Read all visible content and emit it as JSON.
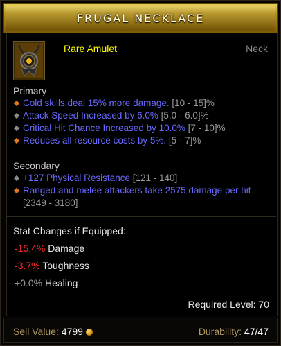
{
  "title": "FRUGAL NECKLACE",
  "item_type": "Rare Amulet",
  "slot": "Neck",
  "primary_label": "Primary",
  "primary_affixes": [
    {
      "text": "Cold skills deal 15% more damage.",
      "range": "[10 - 15]%",
      "bullet": "orange"
    },
    {
      "text": "Attack Speed Increased by 6.0%",
      "range": "[5.0 - 6.0]%",
      "bullet": "grey"
    },
    {
      "text": "Critical Hit Chance Increased by 10.0%",
      "range": "[7 - 10]%",
      "bullet": "grey"
    },
    {
      "text": "Reduces all resource costs by 5%.",
      "range": "[5 - 7]%",
      "bullet": "orange"
    }
  ],
  "secondary_label": "Secondary",
  "secondary_affixes": [
    {
      "text": "+127 Physical Resistance",
      "range": "[121 - 140]",
      "bullet": "grey"
    },
    {
      "text": "Ranged and melee attackers take 2575 damage per hit",
      "range": "[2349 - 3180]",
      "bullet": "orange"
    }
  ],
  "stat_changes_title": "Stat Changes if Equipped:",
  "stat_changes": [
    {
      "value": "-15.4%",
      "label": "Damage",
      "color": "#ff2b2b"
    },
    {
      "value": "-3.7%",
      "label": "Toughness",
      "color": "#ff2b2b"
    },
    {
      "value": "+0.0%",
      "label": "Healing",
      "color": "#9c9c9c"
    }
  ],
  "required_level_label": "Required Level:",
  "required_level": "70",
  "sell_label": "Sell Value:",
  "sell_value": "4799",
  "durability_label": "Durability:",
  "durability_value": "47/47",
  "icons": {
    "amulet": "amulet-icon",
    "gold": "gold-coin-icon",
    "bullet_orange": "orange-diamond-bullet-icon",
    "bullet_grey": "grey-diamond-bullet-icon"
  },
  "colors": {
    "header_gold": "#c9a227",
    "rare_yellow": "#ffff00",
    "magic_blue": "#6969ff",
    "range_grey": "#9a9a9a",
    "negative_red": "#ff2b2b"
  }
}
